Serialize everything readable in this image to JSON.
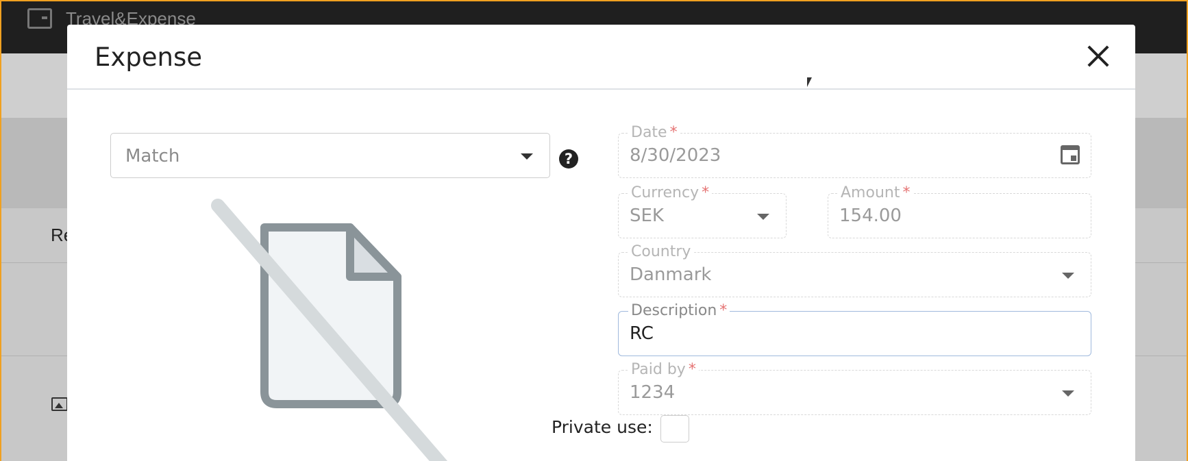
{
  "app": {
    "name": "Travel&Expense"
  },
  "background": {
    "row_text": "Re"
  },
  "modal": {
    "title": "Expense",
    "close_icon": "close-icon"
  },
  "match": {
    "value": "Match",
    "help_icon": "question-circle-icon"
  },
  "form": {
    "date": {
      "label": "Date",
      "required": "*",
      "value": "8/30/2023"
    },
    "currency": {
      "label": "Currency",
      "required": "*",
      "value": "SEK"
    },
    "amount": {
      "label": "Amount",
      "required": "*",
      "value": "154.00"
    },
    "country": {
      "label": "Country",
      "value": "Danmark"
    },
    "description": {
      "label": "Description",
      "required": "*",
      "value": "RC"
    },
    "paid_by": {
      "label": "Paid by",
      "required": "*",
      "value": "1234"
    },
    "private_use": {
      "label": "Private use:"
    }
  },
  "colors": {
    "topbar": "#1f1f1f",
    "active_border": "#9fb9dd",
    "required": "#e57373",
    "placeholder_icon_stroke": "#8a9499",
    "placeholder_icon_fill": "#f1f4f6"
  }
}
